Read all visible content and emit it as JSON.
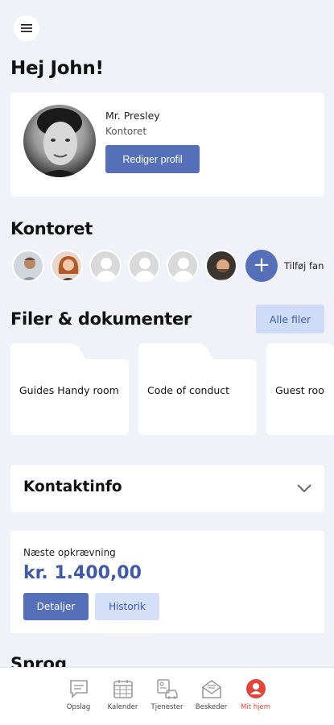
{
  "greeting": "Hej John!",
  "profile": {
    "name": "Mr. Presley",
    "department": "Kontoret",
    "edit_label": "Rediger profil"
  },
  "team": {
    "title": "Kontoret",
    "add_label": "Tilføj fan"
  },
  "files": {
    "title": "Filer & dokumenter",
    "all_files_label": "Alle filer",
    "items": [
      {
        "label": "Guides Handy room"
      },
      {
        "label": "Code of conduct"
      },
      {
        "label": "Guest roo"
      }
    ]
  },
  "contact": {
    "title": "Kontaktinfo"
  },
  "billing": {
    "label": "Næste opkrævning",
    "amount": "kr. 1.400,00",
    "details_label": "Detaljer",
    "history_label": "Historik"
  },
  "language": {
    "title": "Sprog"
  },
  "nav": {
    "items": [
      {
        "label": "Opslag",
        "icon": "chat-icon"
      },
      {
        "label": "Kalender",
        "icon": "calendar-icon"
      },
      {
        "label": "Tjenester",
        "icon": "services-icon"
      },
      {
        "label": "Beskeder",
        "icon": "mail-icon"
      },
      {
        "label": "Mit hjem",
        "icon": "user-icon"
      }
    ],
    "active_color": "#e2463b"
  },
  "colors": {
    "primary": "#5570b8",
    "primary_light": "#cfdcf7",
    "background": "#f1f2f9"
  }
}
